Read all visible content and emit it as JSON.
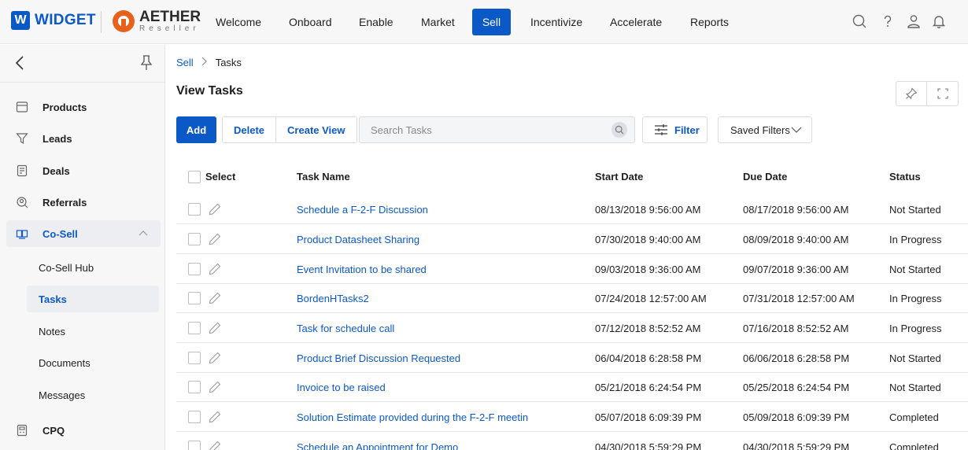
{
  "brand": {
    "widget_mark": "W",
    "widget_name": "WIDGET",
    "aether_name": "AETHER",
    "aether_sub": "Reseller"
  },
  "nav": {
    "items": [
      {
        "label": "Welcome"
      },
      {
        "label": "Onboard"
      },
      {
        "label": "Enable"
      },
      {
        "label": "Market"
      },
      {
        "label": "Sell",
        "active": true
      },
      {
        "label": "Incentivize"
      },
      {
        "label": "Accelerate"
      },
      {
        "label": "Reports"
      }
    ],
    "icons": [
      "search-icon",
      "help-icon",
      "user-icon",
      "bell-icon"
    ]
  },
  "sidebar": {
    "items": [
      {
        "label": "Products",
        "icon": "products-icon"
      },
      {
        "label": "Leads",
        "icon": "leads-icon"
      },
      {
        "label": "Deals",
        "icon": "deals-icon"
      },
      {
        "label": "Referrals",
        "icon": "referrals-icon"
      },
      {
        "label": "Co-Sell",
        "icon": "cosell-icon",
        "expanded": true
      },
      {
        "label": "CPQ",
        "icon": "cpq-icon"
      }
    ],
    "subitems": [
      {
        "label": "Co-Sell Hub"
      },
      {
        "label": "Tasks",
        "active": true
      },
      {
        "label": "Notes"
      },
      {
        "label": "Documents"
      },
      {
        "label": "Messages"
      }
    ]
  },
  "breadcrumb": {
    "parent": "Sell",
    "current": "Tasks"
  },
  "page": {
    "title": "View Tasks"
  },
  "toolbar": {
    "add_label": "Add",
    "delete_label": "Delete",
    "create_view_label": "Create View",
    "search_placeholder": "Search Tasks",
    "filter_label": "Filter",
    "saved_filters_label": "Saved Filters"
  },
  "table": {
    "columns": {
      "select": "Select",
      "name": "Task Name",
      "start": "Start Date",
      "due": "Due Date",
      "status": "Status"
    },
    "rows": [
      {
        "name": "Schedule a F-2-F Discussion",
        "start": "08/13/2018 9:56:00 AM",
        "due": "08/17/2018 9:56:00 AM",
        "status": "Not Started"
      },
      {
        "name": "Product Datasheet Sharing",
        "start": "07/30/2018 9:40:00 AM",
        "due": "08/09/2018 9:40:00 AM",
        "status": "In Progress"
      },
      {
        "name": "Event Invitation to be shared",
        "start": "09/03/2018 9:36:00 AM",
        "due": "09/07/2018 9:36:00 AM",
        "status": "Not Started"
      },
      {
        "name": "BordenHTasks2",
        "start": "07/24/2018 12:57:00 AM",
        "due": "07/31/2018 12:57:00 AM",
        "status": "In Progress"
      },
      {
        "name": "Task for schedule call",
        "start": "07/12/2018 8:52:52 AM",
        "due": "07/16/2018 8:52:52 AM",
        "status": "In Progress"
      },
      {
        "name": "Product Brief Discussion Requested",
        "start": "06/04/2018 6:28:58 PM",
        "due": "06/06/2018 6:28:58 PM",
        "status": "Not Started"
      },
      {
        "name": "Invoice to be raised",
        "start": "05/21/2018 6:24:54 PM",
        "due": "05/25/2018 6:24:54 PM",
        "status": "Not Started"
      },
      {
        "name": "Solution Estimate provided during the F-2-F meetin",
        "start": "05/07/2018 6:09:39 PM",
        "due": "05/09/2018 6:09:39 PM",
        "status": "Completed"
      },
      {
        "name": "Schedule an Appointment for Demo",
        "start": "04/30/2018 5:59:29 PM",
        "due": "04/30/2018 5:59:29 PM",
        "status": "Completed"
      }
    ]
  },
  "colors": {
    "accent": "#0b59c7",
    "aether_orange": "#e8611a"
  }
}
